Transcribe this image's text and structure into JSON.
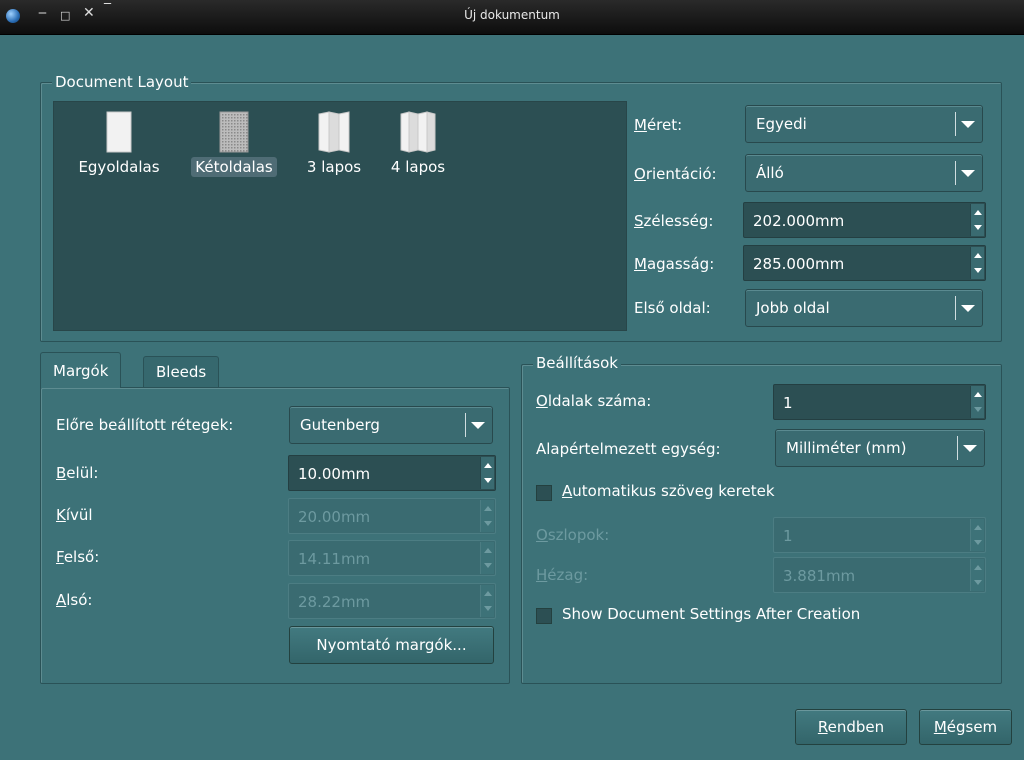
{
  "window": {
    "title": "Új dokumentum"
  },
  "layout_group": {
    "title": "Document Layout",
    "options": [
      {
        "label": "Egyoldalas",
        "icon": "single-page-icon",
        "selected": false
      },
      {
        "label": "Kétoldalas",
        "icon": "double-page-icon",
        "selected": true
      },
      {
        "label": "3 lapos",
        "icon": "three-fold-icon",
        "selected": false
      },
      {
        "label": "4 lapos",
        "icon": "four-fold-icon",
        "selected": false
      }
    ],
    "size_label": "Méret:",
    "size_value": "Egyedi",
    "orientation_label": "Orientáció:",
    "orientation_value": "Álló",
    "width_label": "Szélesség:",
    "width_value": "202.000mm",
    "height_label": "Magasság:",
    "height_value": "285.000mm",
    "first_page_label": "Első oldal:",
    "first_page_value": "Jobb oldal"
  },
  "tabs": [
    {
      "label": "Margók"
    },
    {
      "label": "Bleeds"
    }
  ],
  "margins": {
    "preset_label": "Előre beállított rétegek:",
    "preset_value": "Gutenberg",
    "inside_label": "Belül:",
    "inside_value": "10.00mm",
    "outside_label": "Kívül",
    "outside_value": "20.00mm",
    "top_label": "Felső:",
    "top_value": "14.11mm",
    "bottom_label": "Alsó:",
    "bottom_value": "28.22mm",
    "printer_margins_button": "Nyomtató margók..."
  },
  "settings": {
    "title": "Beállítások",
    "pages_label": "Oldalak száma:",
    "pages_value": "1",
    "unit_label": "Alapértelmezett egység:",
    "unit_value": "Milliméter (mm)",
    "auto_frames_label": "Automatikus szöveg keretek",
    "columns_label": "Oszlopok:",
    "columns_value": "1",
    "gap_label": "Hézag:",
    "gap_value": "3.881mm",
    "show_settings_label": "Show Document Settings After Creation"
  },
  "buttons": {
    "ok": "Rendben",
    "cancel": "Mégsem"
  },
  "colors": {
    "background": "#3d7278",
    "field_dark": "#2c4f53",
    "selection": "#4f6c75"
  }
}
